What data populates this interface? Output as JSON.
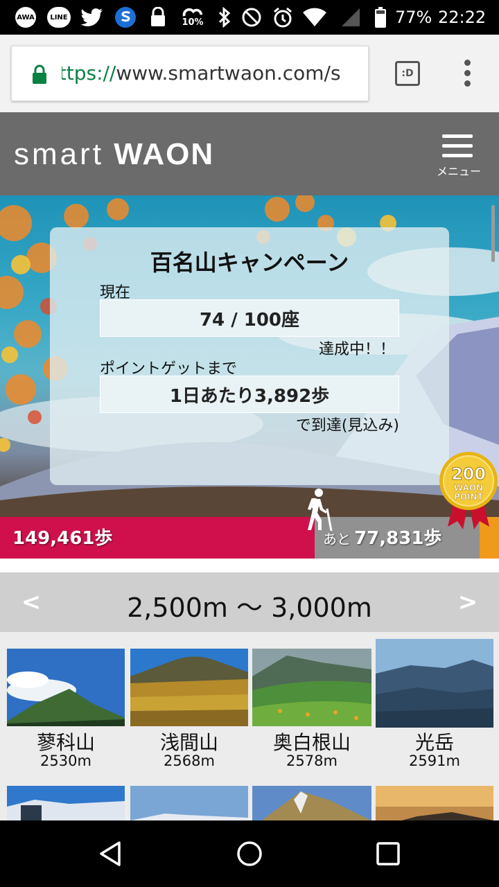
{
  "status_bar": {
    "awa": "AWA",
    "line": "LINE",
    "data_saver": "10%",
    "battery": "77%",
    "time": "22:22"
  },
  "browser": {
    "url_scheme": "https://",
    "url_host": "www.smartwaon.com/s",
    "reader_label": ":D"
  },
  "header": {
    "logo_light": "smart",
    "logo_bold": "WAON",
    "menu_label": "メニュー"
  },
  "campaign": {
    "title": "百名山キャンペーン",
    "current_label": "現在",
    "count": "74 / 100座",
    "achieving": "達成中！！",
    "until_label": "ポイントゲットまで",
    "daily_steps": "1日あたり3,892歩",
    "reach_label": "で到達(見込み)"
  },
  "medal": {
    "points": "200",
    "line1": "WAON",
    "line2": "POINT"
  },
  "progress": {
    "walked": "149,461歩",
    "remaining_prefix": "あと",
    "remaining_value": "77,831歩",
    "walked_fraction": 0.63
  },
  "range": {
    "prev": "<",
    "label": "2,500m 〜 3,000m",
    "next": ">"
  },
  "mountains": [
    {
      "name": "蓼科山",
      "elevation": "2530m"
    },
    {
      "name": "浅間山",
      "elevation": "2568m"
    },
    {
      "name": "奥白根山",
      "elevation": "2578m"
    },
    {
      "name": "光岳",
      "elevation": "2591m"
    }
  ],
  "colors": {
    "progress_fill": "#d0104c",
    "progress_track": "#919191",
    "progress_end": "#f09a1c",
    "header_bg": "#6b6b6b",
    "url_secure": "#0b8043"
  }
}
